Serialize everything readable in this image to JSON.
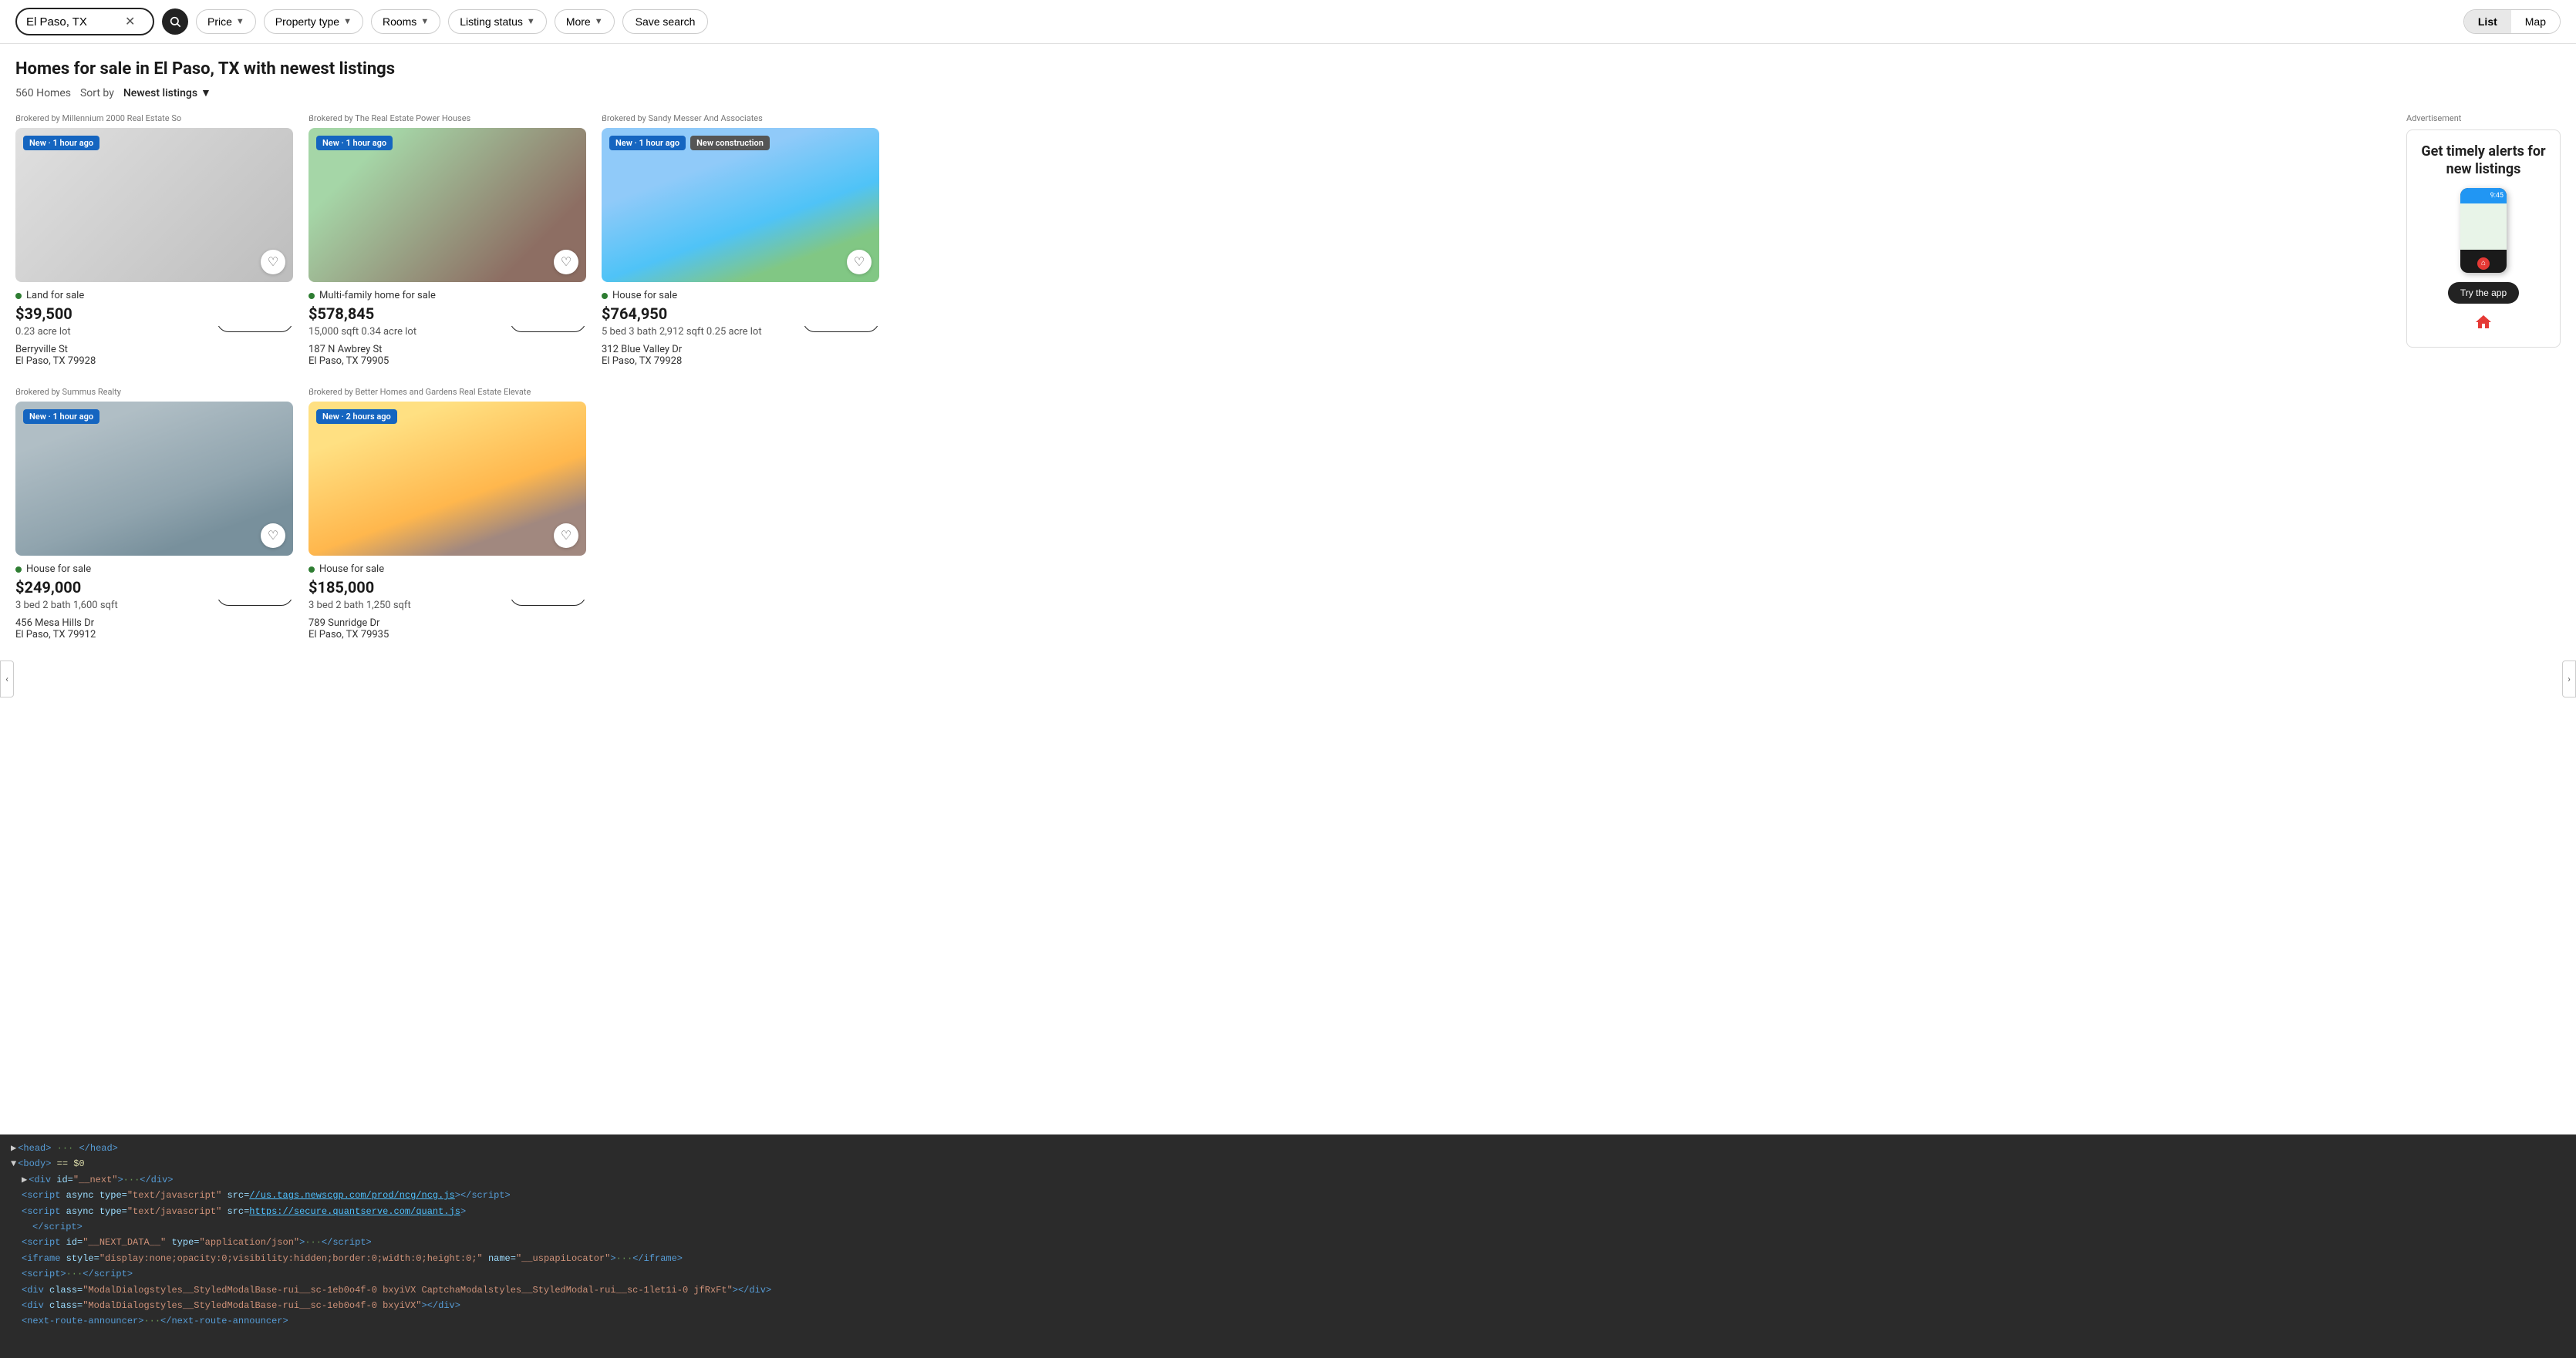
{
  "header": {
    "search_value": "El Paso, TX",
    "filters": [
      {
        "id": "price",
        "label": "Price"
      },
      {
        "id": "property-type",
        "label": "Property type"
      },
      {
        "id": "rooms",
        "label": "Rooms"
      },
      {
        "id": "listing-status",
        "label": "Listing status"
      },
      {
        "id": "more",
        "label": "More"
      }
    ],
    "save_search_label": "Save search",
    "view_list_label": "List",
    "view_map_label": "Map"
  },
  "page": {
    "title": "Homes for sale in El Paso, TX with newest listings",
    "count": "560 Homes",
    "sort_label": "Sort by",
    "sort_value": "Newest listings"
  },
  "listings": [
    {
      "brokered_by": "Brokered by Millennium 2000 Real Estate So",
      "badge": "New · 1 hour ago",
      "badge2": null,
      "property_type": "Land for sale",
      "price": "$39,500",
      "details": "0.23 acre lot",
      "address_line1": "Berryville St",
      "address_line2": "El Paso, TX 79928",
      "img_class": "img-land"
    },
    {
      "brokered_by": "Brokered by The Real Estate Power Houses",
      "badge": "New · 1 hour ago",
      "badge2": null,
      "property_type": "Multi-family home for sale",
      "price": "$578,845",
      "details": "15,000 sqft  0.34 acre lot",
      "address_line1": "187 N Awbrey St",
      "address_line2": "El Paso, TX 79905",
      "img_class": "img-multifam"
    },
    {
      "brokered_by": "Brokered by Sandy Messer And Associates",
      "badge": "New · 1 hour ago",
      "badge2": "New construction",
      "property_type": "House for sale",
      "price": "$764,950",
      "details": "5 bed  3 bath  2,912 sqft  0.25 acre lot",
      "address_line1": "312 Blue Valley Dr",
      "address_line2": "El Paso, TX 79928",
      "img_class": "img-house1"
    },
    {
      "brokered_by": "Brokered by Summus Realty",
      "badge": "New · 1 hour ago",
      "badge2": null,
      "property_type": "House for sale",
      "price": "$249,000",
      "details": "3 bed  2 bath  1,600 sqft",
      "address_line1": "456 Mesa Hills Dr",
      "address_line2": "El Paso, TX 79912",
      "img_class": "img-house2"
    },
    {
      "brokered_by": "Brokered by Better Homes and Gardens Real Estate Elevate",
      "badge": "New · 2 hours ago",
      "badge2": null,
      "property_type": "House for sale",
      "price": "$185,000",
      "details": "3 bed  2 bath  1,250 sqft",
      "address_line1": "789 Sunridge Dr",
      "address_line2": "El Paso, TX 79935",
      "img_class": "img-house3"
    }
  ],
  "ad": {
    "headline": "Get timely alerts for new listings",
    "cta": "Try the app"
  },
  "devtools": {
    "lines": [
      {
        "indent": 0,
        "html": "<span class='triangle'>▶</span><span class='tag'>&lt;head&gt;</span> <span class='comment'>···</span> <span class='tag'>&lt;/head&gt;</span>"
      },
      {
        "indent": 0,
        "html": "<span class='triangle'>▼</span><span class='tag'>&lt;body&gt;</span> <span class='body-eq'>== $0</span>"
      },
      {
        "indent": 1,
        "html": "<span class='triangle'>▶</span><span class='tag'>&lt;div</span> <span class='attr'>id=</span><span class='val'>\"__next\"</span><span class='tag'>&gt;</span><span class='comment'>···</span><span class='tag'>&lt;/div&gt;</span>"
      },
      {
        "indent": 1,
        "html": "<span class='tag'>&lt;script</span> <span class='attr'>async</span> <span class='attr'>type=</span><span class='val'>\"text/javascript\"</span> <span class='attr'>src=</span><span class='link'>//us.tags.newscgp.com/prod/ncg/ncg.js</span><span class='tag'>&gt;&lt;/script&gt;</span>"
      },
      {
        "indent": 1,
        "html": "<span class='tag'>&lt;script</span> <span class='attr'>async</span> <span class='attr'>type=</span><span class='val'>\"text/javascript\"</span> <span class='attr'>src=</span><span class='link'>https://secure.quantserve.com/quant.js</span><span class='tag'>&gt;</span>"
      },
      {
        "indent": 2,
        "html": "<span class='tag'>&lt;/script&gt;</span>"
      },
      {
        "indent": 1,
        "html": "<span class='tag'>&lt;script</span> <span class='attr'>id=</span><span class='val'>\"__NEXT_DATA__\"</span> <span class='attr'>type=</span><span class='val'>\"application/json\"</span><span class='tag'>&gt;</span><span class='comment'>···</span><span class='tag'>&lt;/script&gt;</span>"
      },
      {
        "indent": 1,
        "html": "<span class='tag'>&lt;iframe</span> <span class='attr'>style=</span><span class='val'>\"display:none;opacity:0;visibility:hidden;border:0;width:0;height:0;\"</span> <span class='attr'>name=</span><span class='val'>\"__uspapiLocator\"</span><span class='tag'>&gt;</span><span class='comment'>···</span><span class='tag'>&lt;/iframe&gt;</span>"
      },
      {
        "indent": 1,
        "html": "<span class='tag'>&lt;script&gt;</span><span class='comment'>···</span><span class='tag'>&lt;/script&gt;</span>"
      },
      {
        "indent": 1,
        "html": "<span class='tag'>&lt;div</span> <span class='attr'>class=</span><span class='val'>\"ModalDialogstyles__StyledModalBase-rui__sc-1eb0o4f-0 bxyiVX CaptchaModalstyles__StyledModal-rui__sc-1let1i-0 jfRxFt\"</span><span class='tag'>&gt;&lt;/div&gt;</span>"
      },
      {
        "indent": 1,
        "html": "<span class='tag'>&lt;div</span> <span class='attr'>class=</span><span class='val'>\"ModalDialogstyles__StyledModalBase-rui__sc-1eb0o4f-0 bxyiVX\"</span><span class='tag'>&gt;&lt;/div&gt;</span>"
      },
      {
        "indent": 1,
        "html": "<span class='tag'>&lt;next-route-announcer&gt;</span><span class='comment'>···</span><span class='tag'>&lt;/next-route-announcer&gt;</span>"
      }
    ]
  }
}
